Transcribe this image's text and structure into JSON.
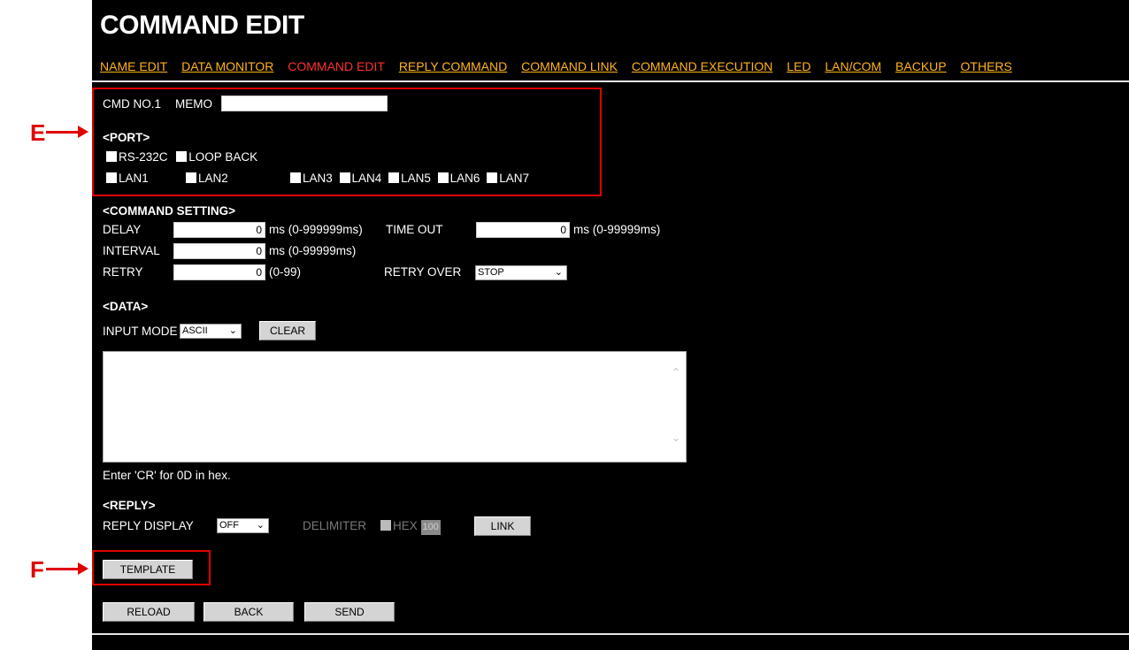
{
  "callouts": {
    "e": "E",
    "f": "F"
  },
  "page_title": "COMMAND EDIT",
  "nav": [
    {
      "label": "NAME EDIT",
      "active": false
    },
    {
      "label": "DATA MONITOR",
      "active": false
    },
    {
      "label": "COMMAND EDIT",
      "active": true
    },
    {
      "label": "REPLY COMMAND",
      "active": false
    },
    {
      "label": "COMMAND LINK",
      "active": false
    },
    {
      "label": "COMMAND EXECUTION",
      "active": false
    },
    {
      "label": "LED",
      "active": false
    },
    {
      "label": "LAN/COM",
      "active": false
    },
    {
      "label": "BACKUP",
      "active": false
    },
    {
      "label": "OTHERS",
      "active": false
    }
  ],
  "cmd": {
    "label": "CMD NO.1",
    "memo_label": "MEMO",
    "memo_value": ""
  },
  "port": {
    "heading": "<PORT>",
    "rs232c": "RS-232C",
    "loopback": "LOOP BACK",
    "lan1": "LAN1",
    "lan2": "LAN2",
    "lan3": "LAN3",
    "lan4": "LAN4",
    "lan5": "LAN5",
    "lan6": "LAN6",
    "lan7": "LAN7"
  },
  "command_setting": {
    "heading": "<COMMAND SETTING>",
    "delay_label": "DELAY",
    "delay_value": "0",
    "delay_range": "ms (0-999999ms)",
    "timeout_label": "TIME OUT",
    "timeout_value": "0",
    "timeout_range": "ms (0-99999ms)",
    "interval_label": "INTERVAL",
    "interval_value": "0",
    "interval_range": "ms (0-99999ms)",
    "retry_label": "RETRY",
    "retry_value": "0",
    "retry_range": "(0-99)",
    "retry_over_label": "RETRY OVER",
    "retry_over_value": "STOP"
  },
  "data": {
    "heading": "<DATA>",
    "input_mode_label": "INPUT MODE",
    "input_mode_value": "ASCII",
    "clear_button": "CLEAR",
    "textarea_value": "",
    "hint": "Enter 'CR' for 0D in hex."
  },
  "reply": {
    "heading": "<REPLY>",
    "display_label": "REPLY DISPLAY",
    "display_value": "OFF",
    "delimiter_label": "DELIMITER",
    "hex_label": "HEX",
    "hex_value": "100",
    "link_button": "LINK"
  },
  "buttons": {
    "template": "TEMPLATE",
    "reload": "RELOAD",
    "back": "BACK",
    "send": "SEND"
  },
  "colors": {
    "background": "#000000",
    "nav_link": "#ffb31a",
    "nav_active": "#ff3030",
    "highlight": "#e00000"
  }
}
